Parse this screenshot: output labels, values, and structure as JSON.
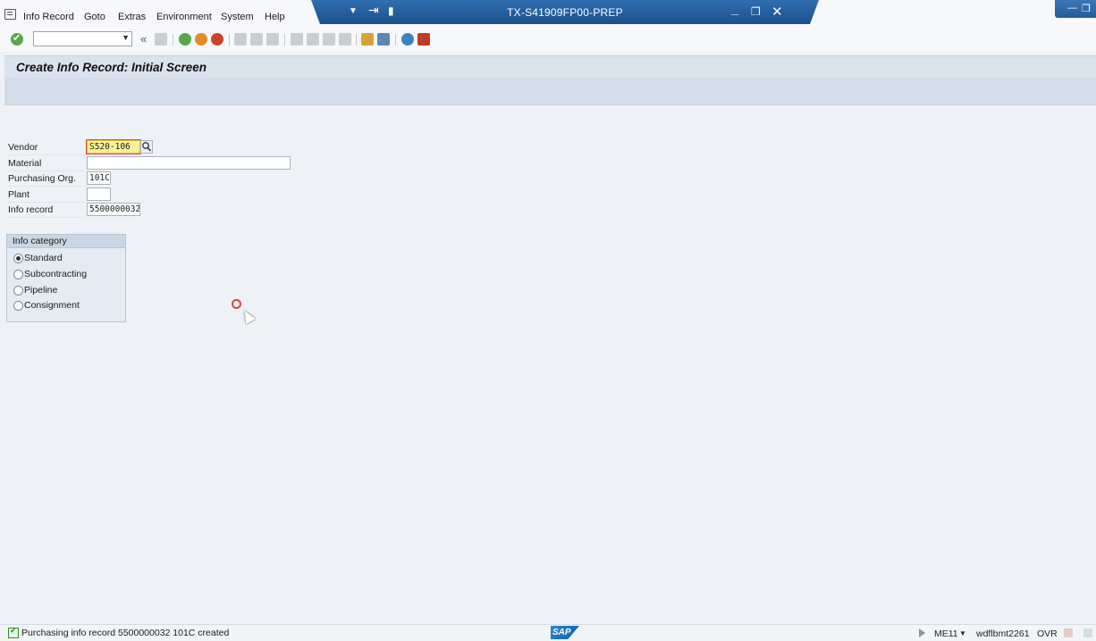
{
  "menu": {
    "items": [
      "Info Record",
      "Goto",
      "Extras",
      "Environment",
      "System",
      "Help"
    ]
  },
  "window": {
    "title": "TX-S41909FP00-PREP"
  },
  "toolbar": {
    "command_value": "",
    "icons": [
      "enter-icon",
      "save-icon",
      "back-icon",
      "exit-icon",
      "cancel-icon",
      "print-icon",
      "find-icon",
      "find-next-icon",
      "first-page-icon",
      "previous-page-icon",
      "next-page-icon",
      "last-page-icon",
      "create-session-icon",
      "shortcut-icon",
      "help-icon",
      "customize-icon"
    ]
  },
  "page": {
    "title": "Create Info Record: Initial Screen"
  },
  "form": {
    "vendor_label": "Vendor",
    "vendor_value": "S520-106",
    "material_label": "Material",
    "material_value": "",
    "purch_org_label": "Purchasing Org.",
    "purch_org_value": "101C",
    "plant_label": "Plant",
    "plant_value": "",
    "info_record_label": "Info record",
    "info_record_value": "5500000032"
  },
  "info_category": {
    "title": "Info category",
    "options": [
      "Standard",
      "Subcontracting",
      "Pipeline",
      "Consignment"
    ],
    "selected": "Standard"
  },
  "status": {
    "message": "Purchasing info record 5500000032 101C  created",
    "logo": "SAP",
    "transaction": "ME11",
    "server": "wdflbmt2261",
    "mode": "OVR"
  },
  "colors": {
    "title_bar": "#1c4f8a",
    "required_field": "#fbf19a",
    "ok_green": "#5aa64a"
  }
}
